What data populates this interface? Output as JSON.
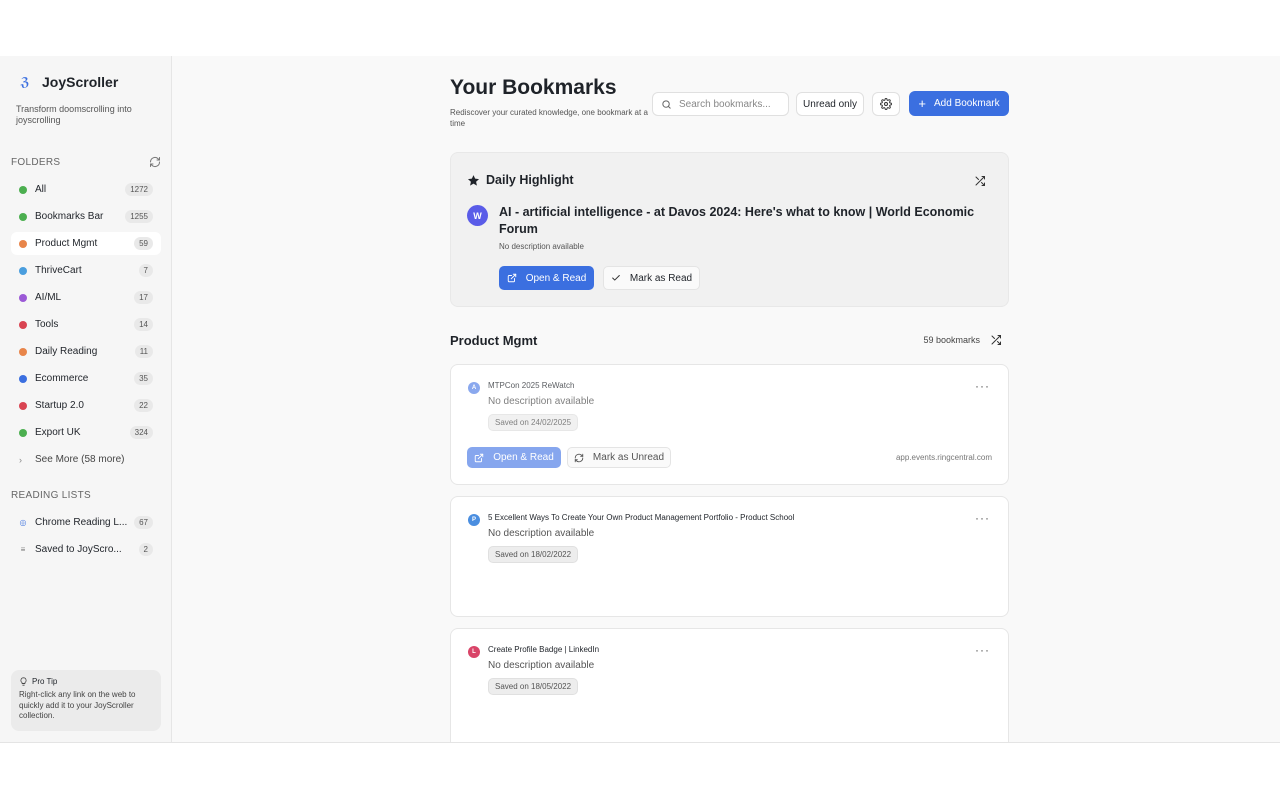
{
  "brand": {
    "name": "JoyScroller",
    "tagline": "Transform doomscrolling into joyscrolling"
  },
  "sidebar": {
    "folders_heading": "FOLDERS",
    "folders": [
      {
        "label": "All",
        "count": "1272",
        "color": "#4caf50"
      },
      {
        "label": "Bookmarks Bar",
        "count": "1255",
        "color": "#4caf50"
      },
      {
        "label": "Product Mgmt",
        "count": "59",
        "color": "#e8854a"
      },
      {
        "label": "ThriveCart",
        "count": "7",
        "color": "#4a9ede"
      },
      {
        "label": "AI/ML",
        "count": "17",
        "color": "#9b59d6"
      },
      {
        "label": "Tools",
        "count": "14",
        "color": "#d94452"
      },
      {
        "label": "Daily Reading",
        "count": "11",
        "color": "#e8854a"
      },
      {
        "label": "Ecommerce",
        "count": "35",
        "color": "#3b6fe0"
      },
      {
        "label": "Startup 2.0",
        "count": "22",
        "color": "#d94452"
      },
      {
        "label": "Export UK",
        "count": "324",
        "color": "#4caf50"
      }
    ],
    "see_more": "See More (58 more)",
    "reading_heading": "READING LISTS",
    "reading_lists": [
      {
        "label": "Chrome Reading L...",
        "count": "67",
        "icon": "chrome-icon"
      },
      {
        "label": "Saved to JoyScro...",
        "count": "2",
        "icon": "list-icon"
      }
    ],
    "tip": {
      "title": "Pro Tip",
      "body": "Right-click any link on the web to quickly add it to your JoyScroller collection."
    }
  },
  "header": {
    "title": "Your Bookmarks",
    "subtitle": "Rediscover your curated knowledge, one bookmark at a time",
    "search_placeholder": "Search bookmarks...",
    "unread_label": "Unread only",
    "add_label": "Add Bookmark"
  },
  "highlight": {
    "heading": "Daily Highlight",
    "avatar": "W",
    "title": "AI - artificial intelligence - at Davos 2024: Here's what to know | World Economic Forum",
    "description": "No description available",
    "open_label": "Open & Read",
    "mark_label": "Mark as Read"
  },
  "section": {
    "title": "Product Mgmt",
    "count": "59 bookmarks"
  },
  "cards": [
    {
      "avatar": "A",
      "avatar_color": "#8aa8ee",
      "title": "MTPCon 2025 ReWatch",
      "description": "No description available",
      "date": "Saved on 24/02/2025",
      "open_label": "Open & Read",
      "unread_label": "Mark as Unread",
      "domain": "app.events.ringcentral.com"
    },
    {
      "avatar": "P",
      "avatar_color": "#4a8ee0",
      "title": "5 Excellent Ways To Create Your Own Product Management Portfolio - Product School",
      "description": "No description available",
      "date": "Saved on 18/02/2022"
    },
    {
      "avatar": "L",
      "avatar_color": "#d94468",
      "title": "Create Profile Badge | LinkedIn",
      "description": "No description available",
      "date": "Saved on 18/05/2022"
    }
  ],
  "colors": {
    "accent": "#3b6fe0",
    "accent_faded": "#86a6ee"
  }
}
